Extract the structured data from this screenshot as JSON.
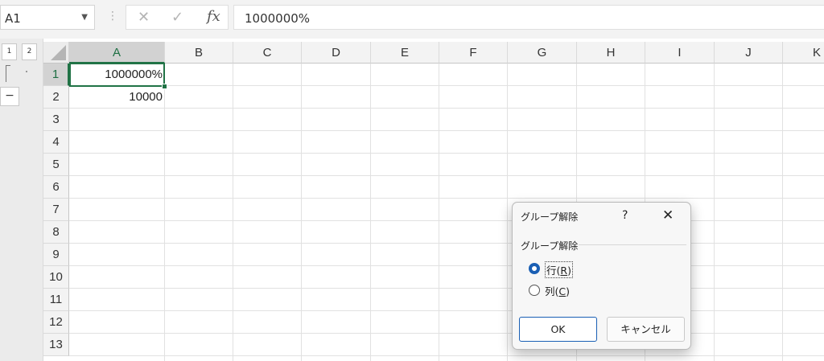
{
  "formula_bar": {
    "name_box": "A1",
    "name_box_arrow": "▼",
    "dots": "⋮",
    "cancel_glyph": "✕",
    "enter_glyph": "✓",
    "fx_label": "fx",
    "formula": "1000000%"
  },
  "outline": {
    "levels": [
      "1",
      "2"
    ],
    "collapse_label": "−"
  },
  "grid": {
    "columns": [
      "A",
      "B",
      "C",
      "D",
      "E",
      "F",
      "G",
      "H",
      "I",
      "J",
      "K"
    ],
    "rows": [
      "1",
      "2",
      "3",
      "4",
      "5",
      "6",
      "7",
      "8",
      "9",
      "10",
      "11",
      "12",
      "13"
    ],
    "selected_cell": "A1",
    "cells": {
      "A1": "1000000%",
      "A2": "10000"
    }
  },
  "dialog": {
    "title": "グループ解除",
    "help": "?",
    "close": "✕",
    "group_label": "グループ解除",
    "options": [
      {
        "label": "行",
        "mnemonic": "R",
        "selected": true
      },
      {
        "label": "列",
        "mnemonic": "C",
        "selected": false
      }
    ],
    "ok_label": "OK",
    "cancel_label": "キャンセル"
  },
  "colors": {
    "accent": "#217346",
    "dialog_focus": "#1a5fb4"
  }
}
